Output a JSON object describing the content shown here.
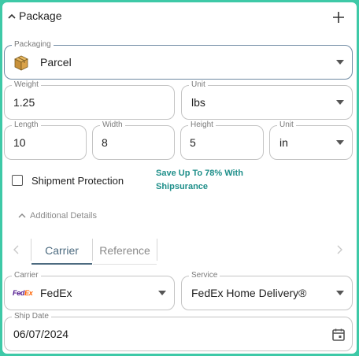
{
  "header": {
    "title": "Package"
  },
  "packaging": {
    "label": "Packaging",
    "value": "Parcel"
  },
  "weight": {
    "label": "Weight",
    "value": "1.25"
  },
  "weight_unit": {
    "label": "Unit",
    "value": "lbs"
  },
  "length": {
    "label": "Length",
    "value": "10"
  },
  "width": {
    "label": "Width",
    "value": "8"
  },
  "height": {
    "label": "Height",
    "value": "5"
  },
  "dim_unit": {
    "label": "Unit",
    "value": "in"
  },
  "protection": {
    "label": "Shipment Protection",
    "promo_line1": "Save Up To 78% With",
    "promo_line2": "Shipsurance",
    "checked": false
  },
  "additional": {
    "label": "Additional Details"
  },
  "tabs": [
    {
      "label": "Carrier",
      "active": true
    },
    {
      "label": "Reference",
      "active": false
    }
  ],
  "carrier": {
    "label": "Carrier",
    "value": "FedEx",
    "logo_text_1": "Fed",
    "logo_text_2": "Ex"
  },
  "service": {
    "label": "Service",
    "value": "FedEx Home Delivery®"
  },
  "ship_date": {
    "label": "Ship Date",
    "value": "06/07/2024"
  },
  "colors": {
    "accent_teal": "#1f8f8a",
    "frame_green": "#3ec9a7",
    "tab_underline": "#4d6b80",
    "fedex_purple": "#4d148c",
    "fedex_orange": "#ff6200"
  },
  "icons": {
    "collapse": "chevron-up-icon",
    "add": "plus-icon",
    "package": "box-icon",
    "calendar": "calendar-icon"
  }
}
